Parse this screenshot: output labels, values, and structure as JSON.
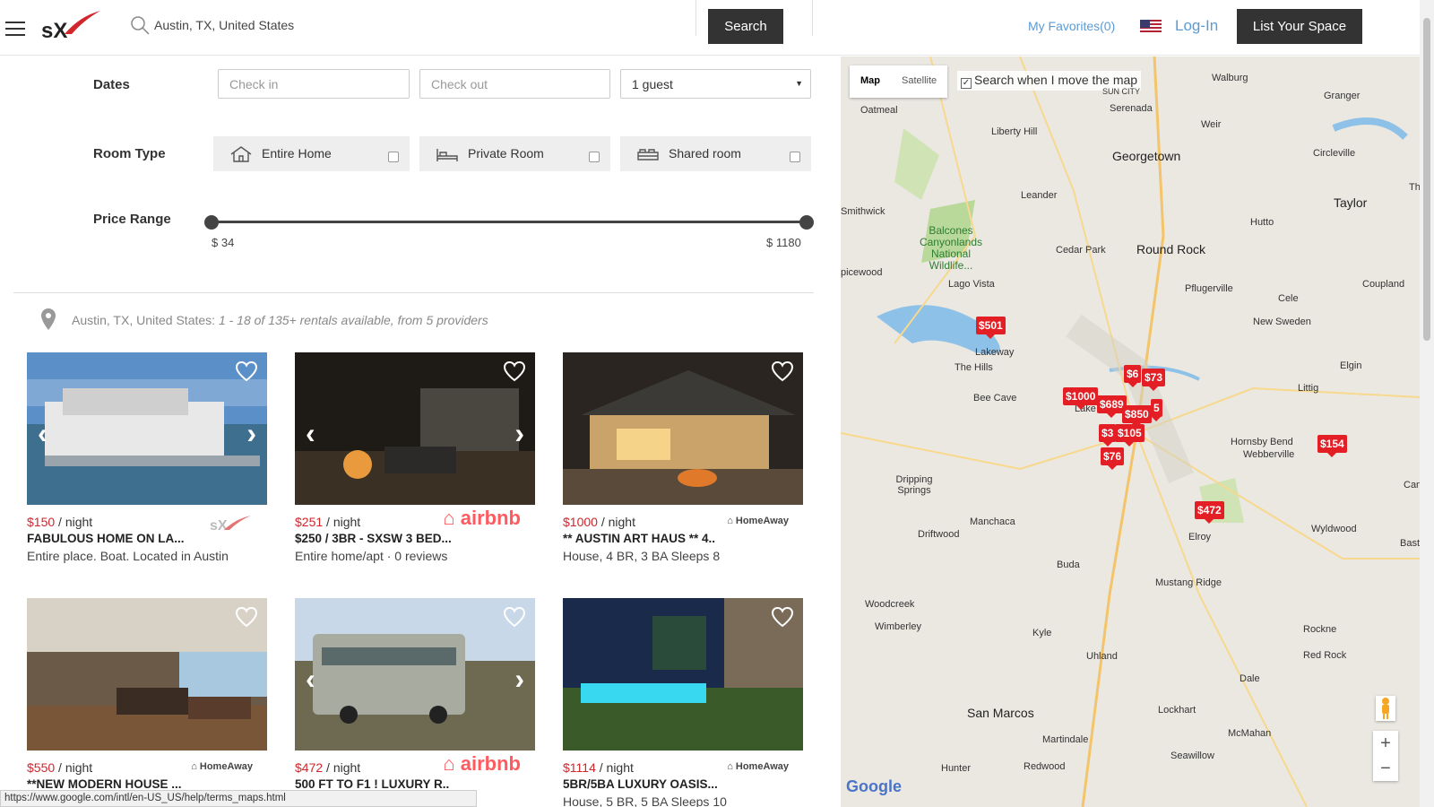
{
  "header": {
    "search_value": "Austin, TX, United States",
    "search_button": "Search",
    "favorites": "My Favorites(0)",
    "login": "Log-In",
    "list_space": "List Your Space"
  },
  "filters": {
    "dates_label": "Dates",
    "check_in_placeholder": "Check in",
    "check_out_placeholder": "Check out",
    "guests": "1 guest",
    "room_type_label": "Room Type",
    "room_types": [
      "Entire Home",
      "Private Room",
      "Shared room"
    ],
    "price_range_label": "Price Range",
    "price_min": "$ 34",
    "price_max": "$ 1180"
  },
  "results": {
    "location": "Austin, TX, United States:",
    "summary": "1 - 18 of 135+ rentals available, from 5 providers"
  },
  "listings": [
    {
      "price": "$150",
      "unit": "/ night",
      "title": "FABULOUS HOME ON LA...",
      "sub": "Entire place. Boat. Located in Austin",
      "provider": "sx"
    },
    {
      "price": "$251",
      "unit": "/ night",
      "title": "$250 / 3BR - SXSW 3 BED...",
      "sub": "Entire home/apt · 0 reviews",
      "provider": "airbnb"
    },
    {
      "price": "$1000",
      "unit": "/ night",
      "title": "** AUSTIN ART HAUS ** 4..",
      "sub": "House, 4 BR, 3 BA Sleeps 8",
      "provider": "HomeAway"
    },
    {
      "price": "$550",
      "unit": "/ night",
      "title": "**NEW MODERN HOUSE ...",
      "sub": "",
      "provider": "HomeAway"
    },
    {
      "price": "$472",
      "unit": "/ night",
      "title": "500 FT TO F1 ! LUXURY R..",
      "sub": "",
      "provider": "airbnb"
    },
    {
      "price": "$1114",
      "unit": "/ night",
      "title": "5BR/5BA LUXURY OASIS...",
      "sub": "House, 5 BR, 5 BA Sleeps 10",
      "provider": "HomeAway"
    }
  ],
  "provider_labels": {
    "airbnb": "airbnb",
    "homeaway": "HomeAway"
  },
  "status_url": "https://www.google.com/intl/en-US_US/help/terms_maps.html",
  "map": {
    "type_map": "Map",
    "type_satellite": "Satellite",
    "move_search": "Search when I move the map",
    "google": "Google",
    "pins": [
      "$501",
      "$1000",
      "$6",
      "$73",
      "$689",
      "$850",
      "5",
      "$3",
      "$105",
      "$76",
      "$472",
      "$154"
    ],
    "places": [
      "Walburg",
      "Granger",
      "Oatmeal",
      "SUN CITY",
      "Serenada",
      "Weir",
      "Liberty Hill",
      "Georgetown",
      "Circleville",
      "Leander",
      "Taylor",
      "Smithwick",
      "Hutto",
      "Balcones Canyonlands National Wildlife...",
      "Cedar Park",
      "Round Rock",
      "picewood",
      "Lago Vista",
      "Pflugerville",
      "Cele",
      "Coupland",
      "New Sweden",
      "Lakeway",
      "The Hills",
      "Elgin",
      "Bee Cave",
      "Littig",
      "Lake",
      "Hornsby Bend",
      "Webberville",
      "Dripping Springs",
      "Manchaca",
      "Elroy",
      "Driftwood",
      "Wyldwood",
      "Buda",
      "Mustang Ridge",
      "Woodcreek",
      "Wimberley",
      "Kyle",
      "Uhland",
      "Rockne",
      "Red Rock",
      "Dale",
      "San Marcos",
      "Lockhart",
      "McMahan",
      "Martindale",
      "Seawillow",
      "Hunter",
      "Redwood",
      "Th",
      "Cam",
      "Bastro"
    ],
    "zoom_in": "+",
    "zoom_out": "−"
  }
}
